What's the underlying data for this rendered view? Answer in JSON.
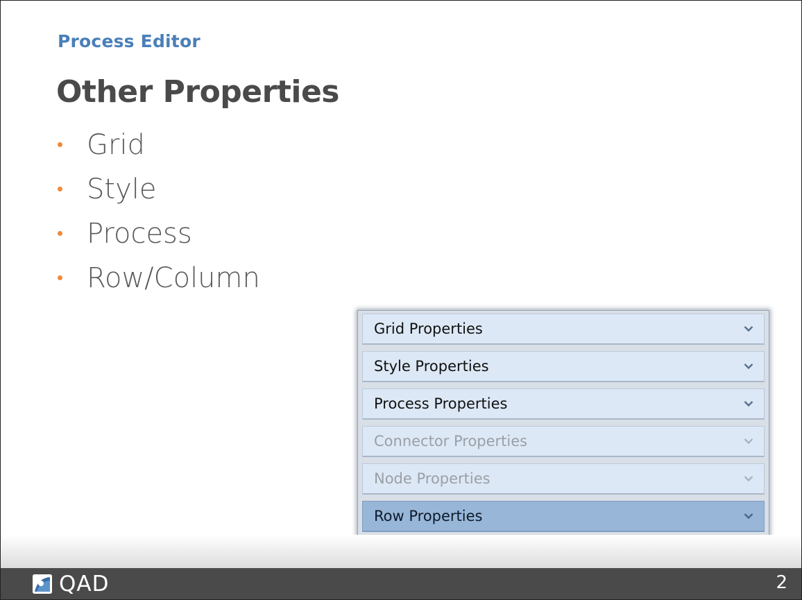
{
  "header": {
    "section_label": "Process Editor",
    "title": "Other Properties"
  },
  "bullets": [
    "Grid",
    "Style",
    "Process",
    "Row/Column"
  ],
  "colors": {
    "section_label": "#4a7fb8",
    "bullet_dot": "#f08a3a",
    "active_row": "#98b6d8",
    "row": "#dde8f6",
    "footer": "#4a4a4a"
  },
  "panel": {
    "rows": [
      {
        "label": "Grid Properties",
        "state": "enabled",
        "icon": "chevron-down-icon"
      },
      {
        "label": "Style Properties",
        "state": "enabled",
        "icon": "chevron-down-icon"
      },
      {
        "label": "Process Properties",
        "state": "enabled",
        "icon": "chevron-down-icon"
      },
      {
        "label": "Connector Properties",
        "state": "disabled",
        "icon": "chevron-down-icon"
      },
      {
        "label": "Node Properties",
        "state": "disabled",
        "icon": "chevron-down-icon"
      },
      {
        "label": "Row Properties",
        "state": "active",
        "icon": "chevron-down-icon"
      }
    ]
  },
  "footer": {
    "logo_text": "QAD",
    "page_number": "2"
  }
}
